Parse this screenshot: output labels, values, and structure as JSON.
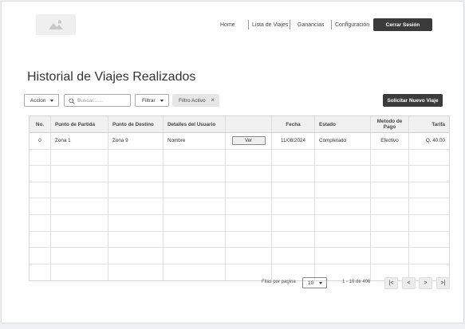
{
  "nav": {
    "home": "Home",
    "trips": "Lista de Viajes",
    "earnings": "Ganancias",
    "settings": "Configuración",
    "logout": "Cerrar Sesión"
  },
  "page": {
    "title": "Historial de Viajes Realizados"
  },
  "toolbar": {
    "action_label": "Accion",
    "search_placeholder": "Buscar.......",
    "filter_label": "Filtrar",
    "active_filter_chip": "Filtro Activo",
    "chip_close": "×",
    "new_trip_label": "Solicitar Nuevo Viaje"
  },
  "table": {
    "headers": {
      "no": "No.",
      "origin": "Punto de Partida",
      "destination": "Punto de Destino",
      "user": "Detalles del Usuario",
      "date": "Fecha",
      "status": "Estado",
      "payment": "Metodo de Pago",
      "fare": "Tarifa"
    },
    "rows": [
      {
        "no": "0",
        "origin": "Zona 1",
        "destination": "Zona 9",
        "user": "Nombre",
        "action": "Ver",
        "date": "11/08/2024",
        "status": "Completado",
        "payment": "Efectivo",
        "fare": "Q. 40.00"
      }
    ],
    "empty_rows": 8
  },
  "pagination": {
    "rows_per_page_label": "Filas por pagina",
    "rows_per_page_value": "10",
    "range_text": "1 - 10 de 406",
    "first": "|<",
    "prev": "<",
    "next": ">",
    "last": ">|"
  }
}
